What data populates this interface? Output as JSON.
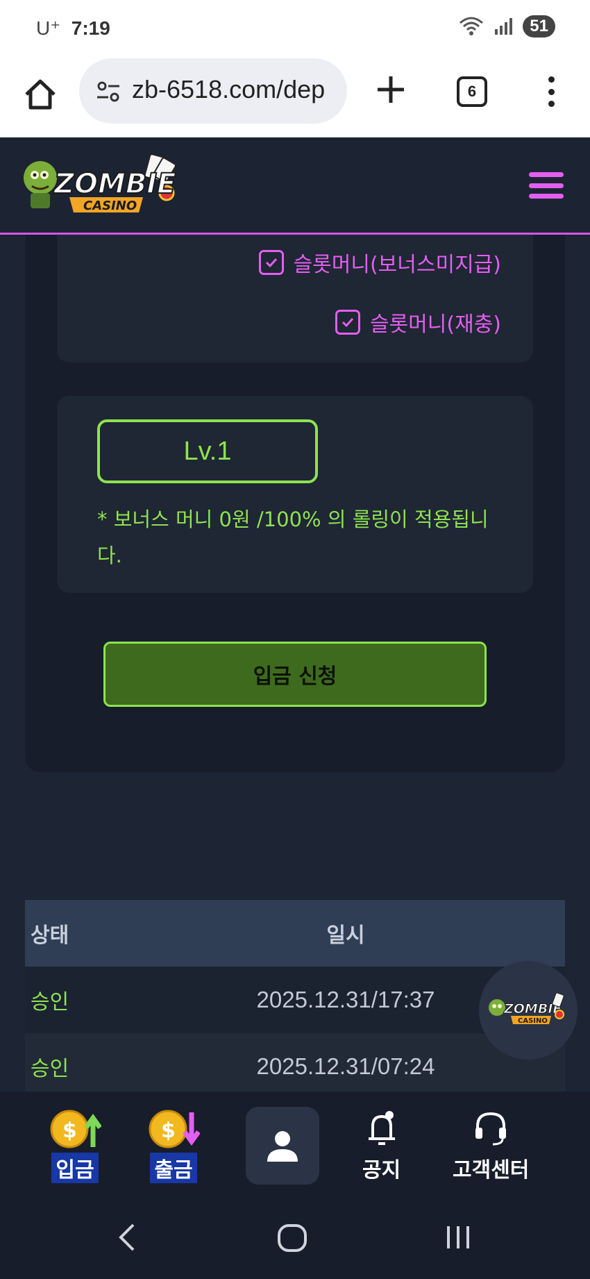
{
  "status_bar": {
    "carrier": "U⁺",
    "time": "7:19",
    "battery": "51"
  },
  "browser": {
    "url": "zb-6518.com/dep",
    "tab_count": "6"
  },
  "site": {
    "logo_text": "ZOMBIE",
    "logo_sub": "CASINO",
    "accent_color": "#e35ff0",
    "green_color": "#8ee34f"
  },
  "options": {
    "items": [
      {
        "label": "슬롯머니(보너스미지급)",
        "checked": true
      },
      {
        "label": "슬롯머니(재충)",
        "checked": true
      }
    ]
  },
  "level": {
    "label": "Lv.1",
    "note": "* 보너스 머니 0원 /100% 의 롤링이 적용됩니다."
  },
  "deposit_button": "입금 신청",
  "history": {
    "headers": [
      "상태",
      "일시"
    ],
    "rows": [
      {
        "status": "승인",
        "datetime": "2025.12.31/17:37"
      },
      {
        "status": "승인",
        "datetime": "2025.12.31/07:24"
      }
    ]
  },
  "bottom_nav": {
    "deposit": "입금",
    "withdraw": "출금",
    "notice": "공지",
    "support": "고객센터"
  }
}
